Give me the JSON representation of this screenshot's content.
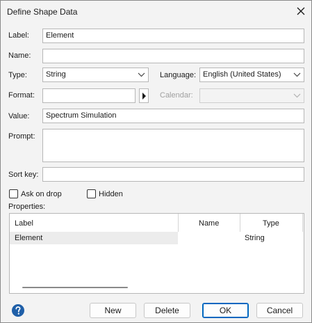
{
  "window": {
    "title": "Define Shape Data"
  },
  "form": {
    "label": {
      "label": "Label:",
      "value": "Element"
    },
    "name": {
      "label": "Name:",
      "value": ""
    },
    "type": {
      "label": "Type:",
      "value": "String"
    },
    "language": {
      "label": "Language:",
      "value": "English (United States)"
    },
    "format": {
      "label": "Format:",
      "value": ""
    },
    "calendar": {
      "label": "Calendar:",
      "value": "",
      "disabled": true
    },
    "value": {
      "label": "Value:",
      "value": "Spectrum Simulation"
    },
    "prompt": {
      "label": "Prompt:",
      "value": ""
    },
    "sort_key": {
      "label": "Sort key:",
      "value": ""
    },
    "ask_on_drop": {
      "label": "Ask on drop",
      "checked": false
    },
    "hidden": {
      "label": "Hidden",
      "checked": false
    }
  },
  "properties": {
    "label": "Properties:",
    "columns": [
      "Label",
      "Name",
      "Type"
    ],
    "rows": [
      {
        "label": "Element",
        "name": "",
        "type": "String"
      }
    ]
  },
  "buttons": {
    "new": "New",
    "delete": "Delete",
    "ok": "OK",
    "cancel": "Cancel"
  },
  "icons": {
    "close": "close-icon",
    "dropdown": "chevron-down-icon",
    "format_picker": "play-triangle-icon",
    "help": "question-mark-icon"
  },
  "colors": {
    "dialog_bg": "#f3f3f3",
    "accent": "#0067c0",
    "help_icon": "#1f5fa8",
    "disabled_text": "#a0a0a0"
  }
}
